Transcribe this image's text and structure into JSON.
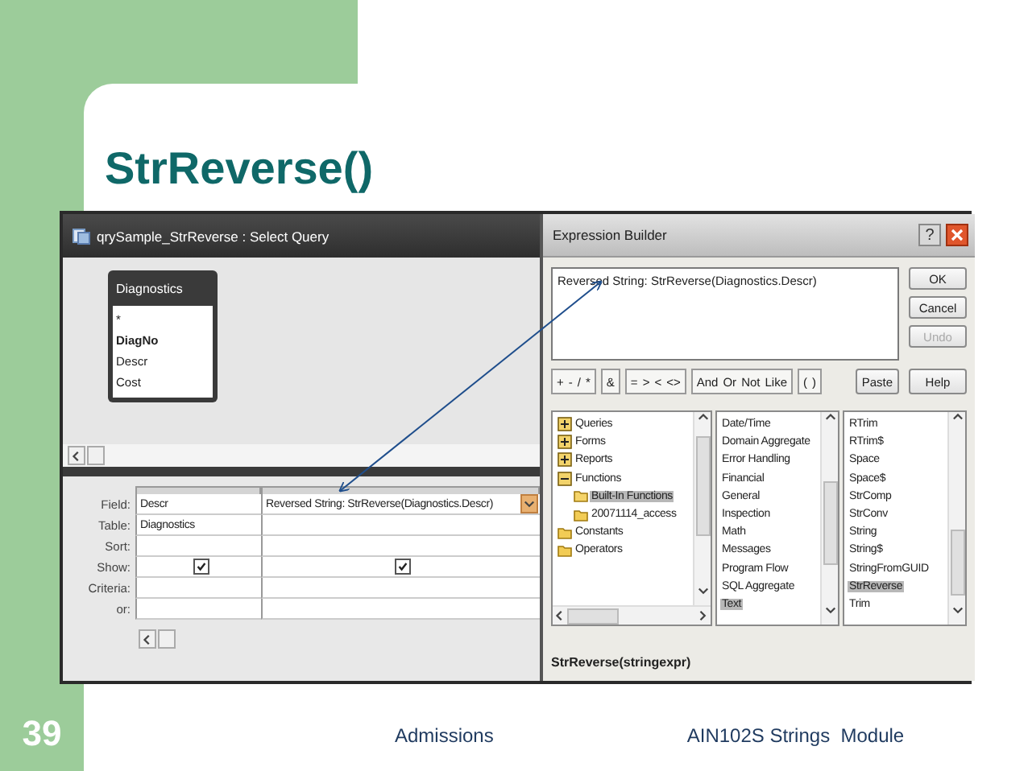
{
  "slide": {
    "title": "StrReverse()",
    "number": "39",
    "footer_left": "Admissions",
    "footer_right": "AIN102S Strings  Module"
  },
  "query_window": {
    "title": "qrySample_StrReverse : Select Query",
    "table": {
      "name": "Diagnostics",
      "fields": [
        {
          "label": "*",
          "primary_key": false
        },
        {
          "label": "DiagNo",
          "primary_key": true
        },
        {
          "label": "Descr",
          "primary_key": false
        },
        {
          "label": "Cost",
          "primary_key": false
        }
      ]
    },
    "grid": {
      "row_labels": [
        "Field:",
        "Table:",
        "Sort:",
        "Show:",
        "Criteria:",
        "or:"
      ],
      "columns": [
        {
          "field": "Descr",
          "table": "Diagnostics",
          "show": true,
          "selected": false
        },
        {
          "field": "Reversed String: StrReverse(Diagnostics.Descr)",
          "show": true,
          "selected": true
        }
      ]
    }
  },
  "expression_builder": {
    "title": "Expression Builder",
    "help_glyph": "?",
    "expression": "Reversed String: StrReverse(Diagnostics.Descr)",
    "side_buttons": [
      {
        "label": "OK",
        "disabled": false
      },
      {
        "label": "Cancel",
        "disabled": false
      },
      {
        "label": "Undo",
        "disabled": true
      },
      {
        "label": "Help",
        "disabled": false
      }
    ],
    "operator_groups": [
      [
        "+",
        "-",
        "/",
        "*"
      ],
      [
        "&"
      ],
      [
        "=",
        ">",
        "<",
        "<>"
      ],
      [
        "And",
        "Or",
        "Not",
        "Like"
      ],
      [
        "(",
        ")"
      ]
    ],
    "paste": "Paste",
    "tree": [
      {
        "label": "Queries",
        "kind": "group",
        "expanded": false,
        "selected": false
      },
      {
        "label": "Forms",
        "kind": "group",
        "expanded": false,
        "selected": false
      },
      {
        "label": "Reports",
        "kind": "group",
        "expanded": false,
        "selected": false
      },
      {
        "label": "Functions",
        "kind": "group",
        "expanded": true,
        "selected": false,
        "children": [
          {
            "label": "Built-In Functions",
            "kind": "folder",
            "selected": true
          },
          {
            "label": "20071114_access",
            "kind": "folder",
            "selected": false
          }
        ]
      },
      {
        "label": "Constants",
        "kind": "folder",
        "selected": false
      },
      {
        "label": "Operators",
        "kind": "folder",
        "selected": false
      }
    ],
    "categories": [
      {
        "label": "Date/Time",
        "selected": false
      },
      {
        "label": "Domain Aggregate",
        "selected": false
      },
      {
        "label": "Error Handling",
        "selected": false
      },
      {
        "label": "Financial",
        "selected": false
      },
      {
        "label": "General",
        "selected": false
      },
      {
        "label": "Inspection",
        "selected": false
      },
      {
        "label": "Math",
        "selected": false
      },
      {
        "label": "Messages",
        "selected": false
      },
      {
        "label": "Program Flow",
        "selected": false
      },
      {
        "label": "SQL Aggregate",
        "selected": false
      },
      {
        "label": "Text",
        "selected": true
      }
    ],
    "functions": [
      {
        "label": "RTrim",
        "selected": false
      },
      {
        "label": "RTrim$",
        "selected": false
      },
      {
        "label": "Space",
        "selected": false
      },
      {
        "label": "Space$",
        "selected": false
      },
      {
        "label": "StrComp",
        "selected": false
      },
      {
        "label": "StrConv",
        "selected": false
      },
      {
        "label": "String",
        "selected": false
      },
      {
        "label": "String$",
        "selected": false
      },
      {
        "label": "StringFromGUID",
        "selected": false
      },
      {
        "label": "StrReverse",
        "selected": true
      },
      {
        "label": "Trim",
        "selected": false
      }
    ],
    "syntax": "StrReverse(stringexpr)"
  }
}
